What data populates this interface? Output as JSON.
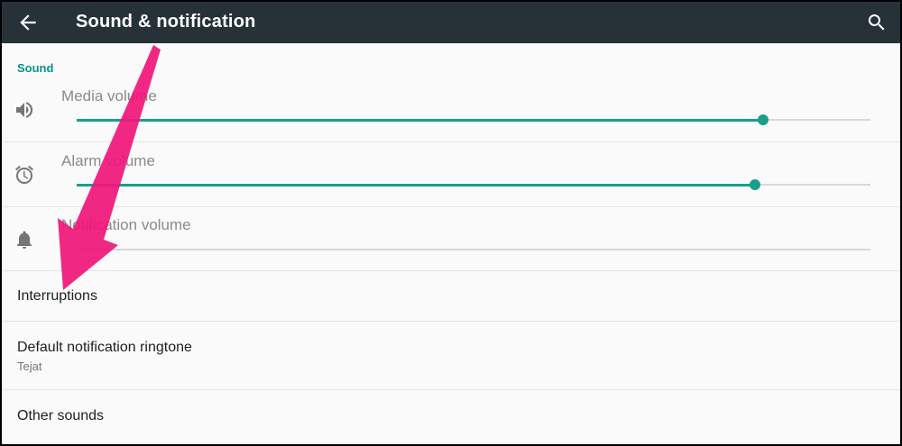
{
  "header": {
    "title": "Sound & notification",
    "back_icon": "arrow-back-icon",
    "search_icon": "search-icon"
  },
  "section": {
    "label": "Sound"
  },
  "volumes": [
    {
      "label": "Media volume",
      "icon": "speaker-icon",
      "level": 0.865
    },
    {
      "label": "Alarm volume",
      "icon": "alarm-clock-icon",
      "level": 0.855
    },
    {
      "label": "Notification volume",
      "icon": "bell-icon",
      "level": 0.0
    }
  ],
  "items": [
    {
      "title": "Interruptions"
    },
    {
      "title": "Default notification ringtone",
      "subtitle": "Tejat"
    },
    {
      "title": "Other sounds"
    }
  ],
  "colors": {
    "accent": "#1a9e8c",
    "appbar": "#263238",
    "arrow": "#f0157a"
  }
}
